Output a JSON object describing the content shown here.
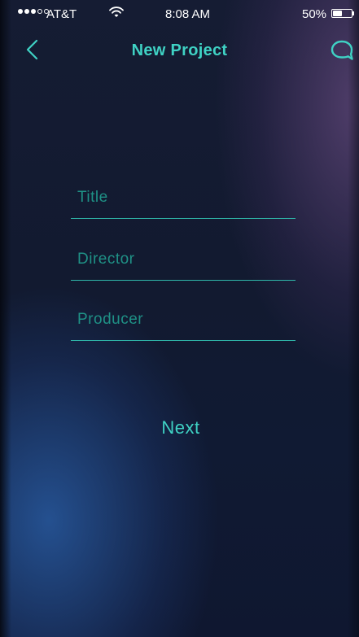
{
  "status_bar": {
    "carrier": "AT&T",
    "signal_bars_filled": 3,
    "signal_bars_total": 5,
    "time": "8:08 AM",
    "battery_percent": "50%",
    "battery_level": 0.5
  },
  "nav": {
    "title": "New Project",
    "back_icon": "chevron-left-icon",
    "chat_icon": "chat-bubble-icon"
  },
  "form": {
    "title_placeholder": "Title",
    "title_value": "",
    "director_placeholder": "Director",
    "director_value": "",
    "producer_placeholder": "Producer",
    "producer_value": ""
  },
  "actions": {
    "next_label": "Next"
  },
  "colors": {
    "accent": "#3fd2c4",
    "placeholder": "#1f9186",
    "underline": "#2fb8aa",
    "background": "#121a30"
  }
}
